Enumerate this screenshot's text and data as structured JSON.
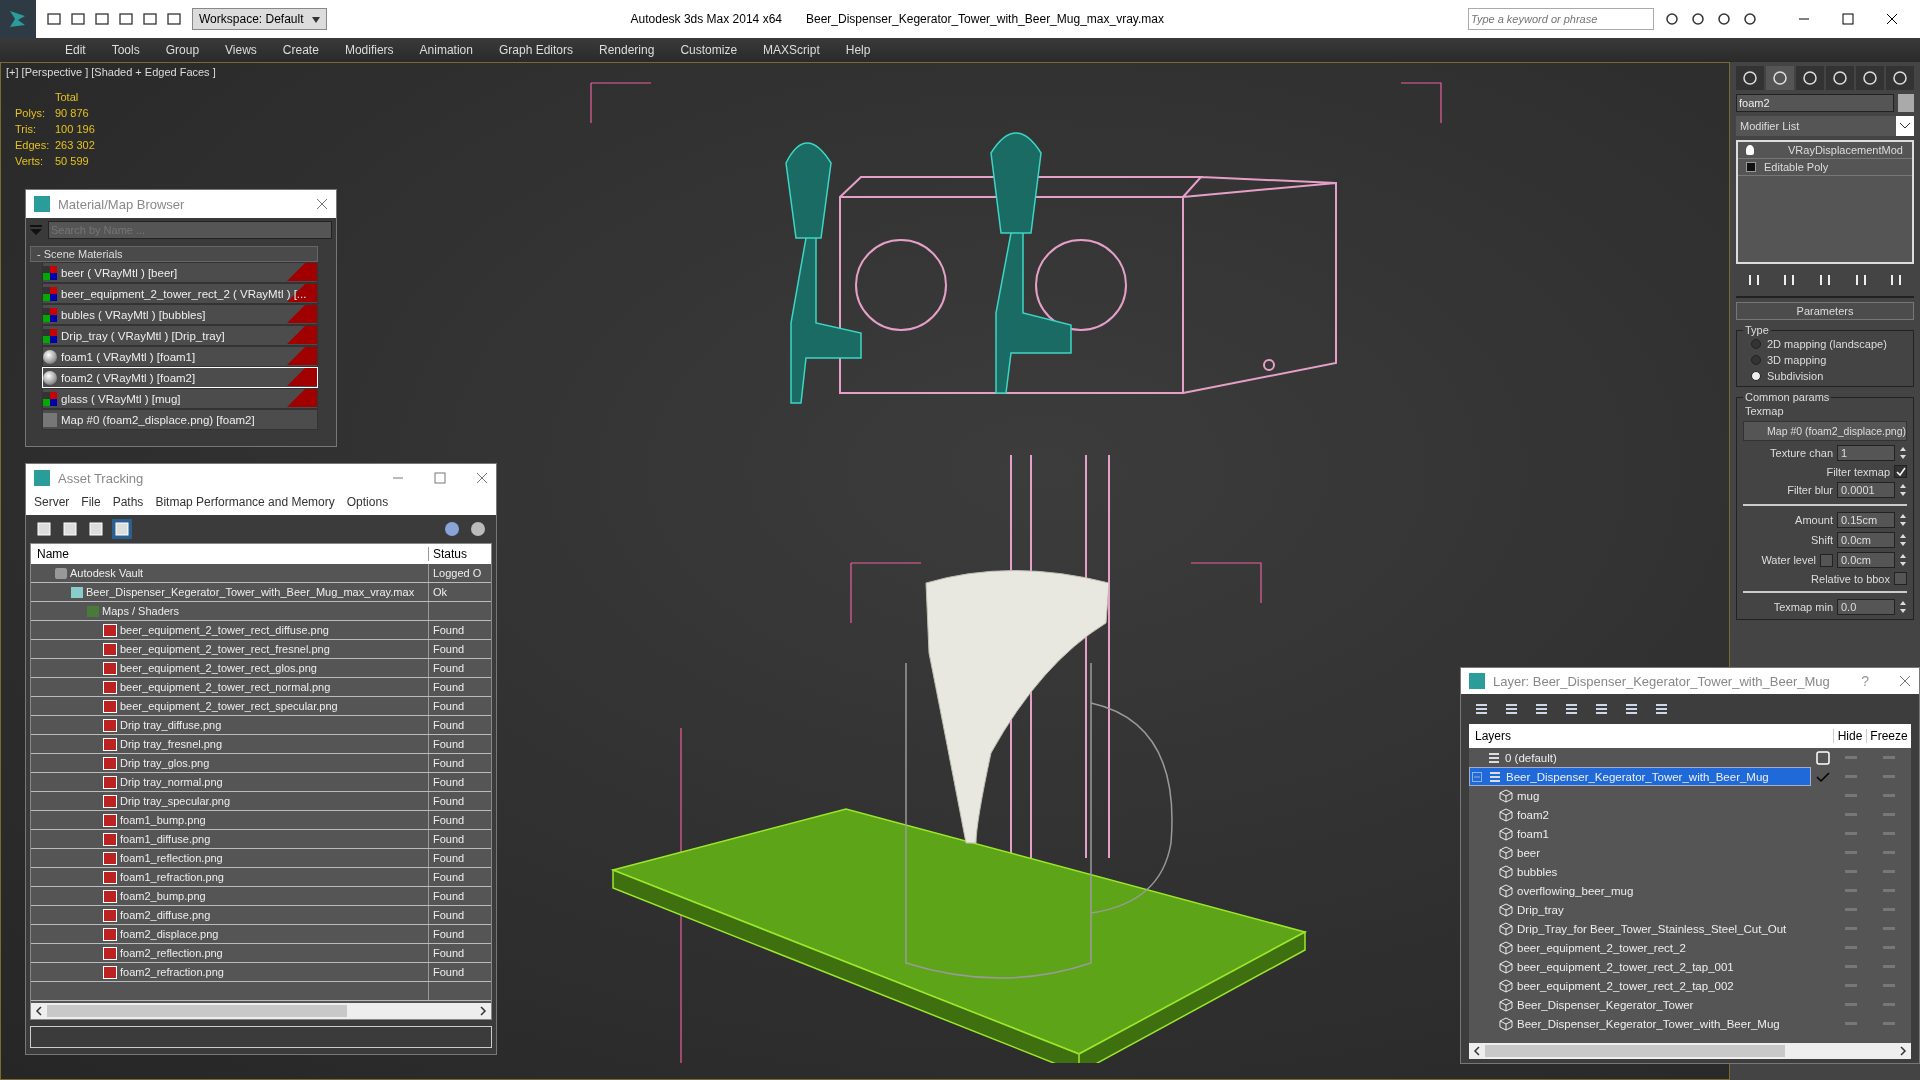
{
  "title_bar": {
    "workspace": "Workspace: Default",
    "app_title": "Autodesk 3ds Max  2014 x64",
    "file_name": "Beer_Dispenser_Kegerator_Tower_with_Beer_Mug_max_vray.max",
    "search": {
      "placeholder": "Type a keyword or phrase"
    }
  },
  "menu": [
    "Edit",
    "Tools",
    "Group",
    "Views",
    "Create",
    "Modifiers",
    "Animation",
    "Graph Editors",
    "Rendering",
    "Customize",
    "MAXScript",
    "Help"
  ],
  "viewport": {
    "label": "[+] [Perspective ] [Shaded + Edged Faces ]",
    "stats_header": "Total",
    "stats": [
      {
        "label": "Polys:",
        "value": "90 876"
      },
      {
        "label": "Tris:",
        "value": "100 196"
      },
      {
        "label": "Edges:",
        "value": "263 302"
      },
      {
        "label": "Verts:",
        "value": "50 599"
      }
    ]
  },
  "material_browser": {
    "title": "Material/Map Browser",
    "search": {
      "placeholder": "Search by Name ..."
    },
    "group": "- Scene Materials",
    "items": [
      {
        "label": "beer  ( VRayMtl ) [beer]",
        "kind": "material",
        "in_scene": true,
        "selected": false
      },
      {
        "label": "beer_equipment_2_tower_rect_2  ( VRayMtl ) [...",
        "kind": "material",
        "in_scene": true,
        "selected": false
      },
      {
        "label": "bubles  ( VRayMtl ) [bubbles]",
        "kind": "material",
        "in_scene": true,
        "selected": false
      },
      {
        "label": "Drip_tray  ( VRayMtl ) [Drip_tray]",
        "kind": "material",
        "in_scene": true,
        "selected": false
      },
      {
        "label": "foam1  ( VRayMtl ) [foam1]",
        "kind": "sphere",
        "in_scene": true,
        "selected": false
      },
      {
        "label": "foam2  ( VRayMtl ) [foam2]",
        "kind": "sphere",
        "in_scene": true,
        "selected": true
      },
      {
        "label": "glass  ( VRayMtl ) [mug]",
        "kind": "material",
        "in_scene": true,
        "selected": false
      },
      {
        "label": "Map #0 (foam2_displace.png) [foam2]",
        "kind": "map",
        "in_scene": false,
        "selected": false
      }
    ]
  },
  "asset_tracking": {
    "title": "Asset Tracking",
    "menu": [
      "Server",
      "File",
      "Paths",
      "Bitmap Performance and Memory",
      "Options"
    ],
    "columns": [
      "Name",
      "Status"
    ],
    "tree": [
      {
        "name": "Autodesk Vault",
        "kind": "vault",
        "status": "Logged O",
        "children": [
          {
            "name": "Beer_Dispenser_Kegerator_Tower_with_Beer_Mug_max_vray.max",
            "kind": "max",
            "status": "Ok",
            "children": [
              {
                "name": "Maps / Shaders",
                "kind": "folder",
                "children": [
                  {
                    "name": "beer_equipment_2_tower_rect_diffuse.png",
                    "kind": "png",
                    "status": "Found"
                  },
                  {
                    "name": "beer_equipment_2_tower_rect_fresnel.png",
                    "kind": "png",
                    "status": "Found"
                  },
                  {
                    "name": "beer_equipment_2_tower_rect_glos.png",
                    "kind": "png",
                    "status": "Found"
                  },
                  {
                    "name": "beer_equipment_2_tower_rect_normal.png",
                    "kind": "png",
                    "status": "Found"
                  },
                  {
                    "name": "beer_equipment_2_tower_rect_specular.png",
                    "kind": "png",
                    "status": "Found"
                  },
                  {
                    "name": "Drip tray_diffuse.png",
                    "kind": "png",
                    "status": "Found"
                  },
                  {
                    "name": "Drip tray_fresnel.png",
                    "kind": "png",
                    "status": "Found"
                  },
                  {
                    "name": "Drip tray_glos.png",
                    "kind": "png",
                    "status": "Found"
                  },
                  {
                    "name": "Drip tray_normal.png",
                    "kind": "png",
                    "status": "Found"
                  },
                  {
                    "name": "Drip tray_specular.png",
                    "kind": "png",
                    "status": "Found"
                  },
                  {
                    "name": "foam1_bump.png",
                    "kind": "png",
                    "status": "Found"
                  },
                  {
                    "name": "foam1_diffuse.png",
                    "kind": "png",
                    "status": "Found"
                  },
                  {
                    "name": "foam1_reflection.png",
                    "kind": "png",
                    "status": "Found"
                  },
                  {
                    "name": "foam1_refraction.png",
                    "kind": "png",
                    "status": "Found"
                  },
                  {
                    "name": "foam2_bump.png",
                    "kind": "png",
                    "status": "Found"
                  },
                  {
                    "name": "foam2_diffuse.png",
                    "kind": "png",
                    "status": "Found"
                  },
                  {
                    "name": "foam2_displace.png",
                    "kind": "png",
                    "status": "Found"
                  },
                  {
                    "name": "foam2_reflection.png",
                    "kind": "png",
                    "status": "Found"
                  },
                  {
                    "name": "foam2_refraction.png",
                    "kind": "png",
                    "status": "Found"
                  }
                ]
              }
            ]
          }
        ]
      }
    ]
  },
  "command_panel": {
    "tabs": [
      {
        "selected": false
      },
      {
        "selected": true
      },
      {
        "selected": false
      },
      {
        "selected": false
      },
      {
        "selected": false
      },
      {
        "selected": false
      }
    ],
    "object_name": "foam2",
    "modifier_list": "Modifier List",
    "stack": [
      {
        "label": "VRayDisplacementMod",
        "kind": "modifier"
      },
      {
        "label": "Editable Poly",
        "kind": "base"
      }
    ],
    "rollout": "Parameters",
    "type_group": "Type",
    "type_options": [
      {
        "label": "2D mapping (landscape)",
        "selected": false
      },
      {
        "label": "3D mapping",
        "selected": false
      },
      {
        "label": "Subdivision",
        "selected": true
      }
    ],
    "common_group": "Common params",
    "texmap_label": "Texmap",
    "texmap": "Map #0 (foam2_displace.png)",
    "fields": [
      {
        "label": "Texture chan",
        "value": "1",
        "kind": "spinner"
      },
      {
        "label": "Filter texmap",
        "kind": "checkbox",
        "checked": true
      },
      {
        "label": "Filter blur",
        "value": "0.0001",
        "kind": "spinner"
      },
      {
        "kind": "rule"
      },
      {
        "label": "Amount",
        "value": "0.15cm",
        "kind": "spinner"
      },
      {
        "label": "Shift",
        "value": "0.0cm",
        "kind": "spinner"
      },
      {
        "label": "Water level",
        "value": "0.0cm",
        "kind": "checkspinner",
        "checked": false
      },
      {
        "label": "Relative to bbox",
        "kind": "checkbox",
        "checked": false
      },
      {
        "kind": "rule"
      },
      {
        "label": "Texmap min",
        "value": "0.0",
        "kind": "spinner"
      }
    ]
  },
  "layer_dialog": {
    "title": "Layer: Beer_Dispenser_Kegerator_Tower_with_Beer_Mug",
    "help": "?",
    "columns": [
      "Layers",
      "Hide",
      "Freeze"
    ],
    "layers": [
      {
        "name": "0 (default)",
        "current": false,
        "selected": false,
        "expanded": false
      },
      {
        "name": "Beer_Dispenser_Kegerator_Tower_with_Beer_Mug",
        "current": true,
        "selected": true,
        "expanded": true,
        "children": [
          {
            "name": "mug"
          },
          {
            "name": "foam2"
          },
          {
            "name": "foam1"
          },
          {
            "name": "beer"
          },
          {
            "name": "bubbles"
          },
          {
            "name": "overflowing_beer_mug"
          },
          {
            "name": "Drip_tray"
          },
          {
            "name": "Drip_Tray_for Beer_Tower_Stainless_Steel_Cut_Out"
          },
          {
            "name": "beer_equipment_2_tower_rect_2"
          },
          {
            "name": "beer_equipment_2_tower_rect_2_tap_001"
          },
          {
            "name": "beer_equipment_2_tower_rect_2_tap_002"
          },
          {
            "name": "Beer_Dispenser_Kegerator_Tower"
          },
          {
            "name": "Beer_Dispenser_Kegerator_Tower_with_Beer_Mug"
          }
        ]
      }
    ]
  }
}
